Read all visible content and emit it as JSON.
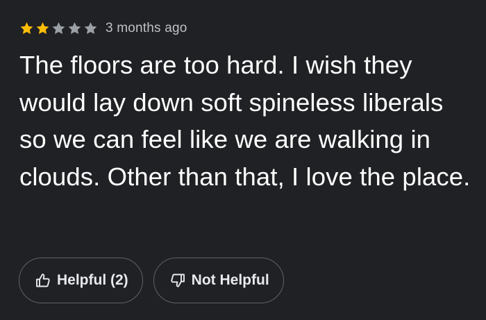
{
  "review": {
    "rating": 2,
    "max_rating": 5,
    "star_filled_color": "#fbbc04",
    "star_empty_color": "#9aa0a6",
    "timestamp": "3 months ago",
    "text": "The floors are too hard. I wish they would lay down soft spineless liberals so we can feel like we are walking in clouds. Other than that, I love the place."
  },
  "actions": {
    "helpful_label": "Helpful (2)",
    "helpful_icon": "thumbs-up-icon",
    "not_helpful_label": "Not Helpful",
    "not_helpful_icon": "thumbs-down-icon"
  }
}
